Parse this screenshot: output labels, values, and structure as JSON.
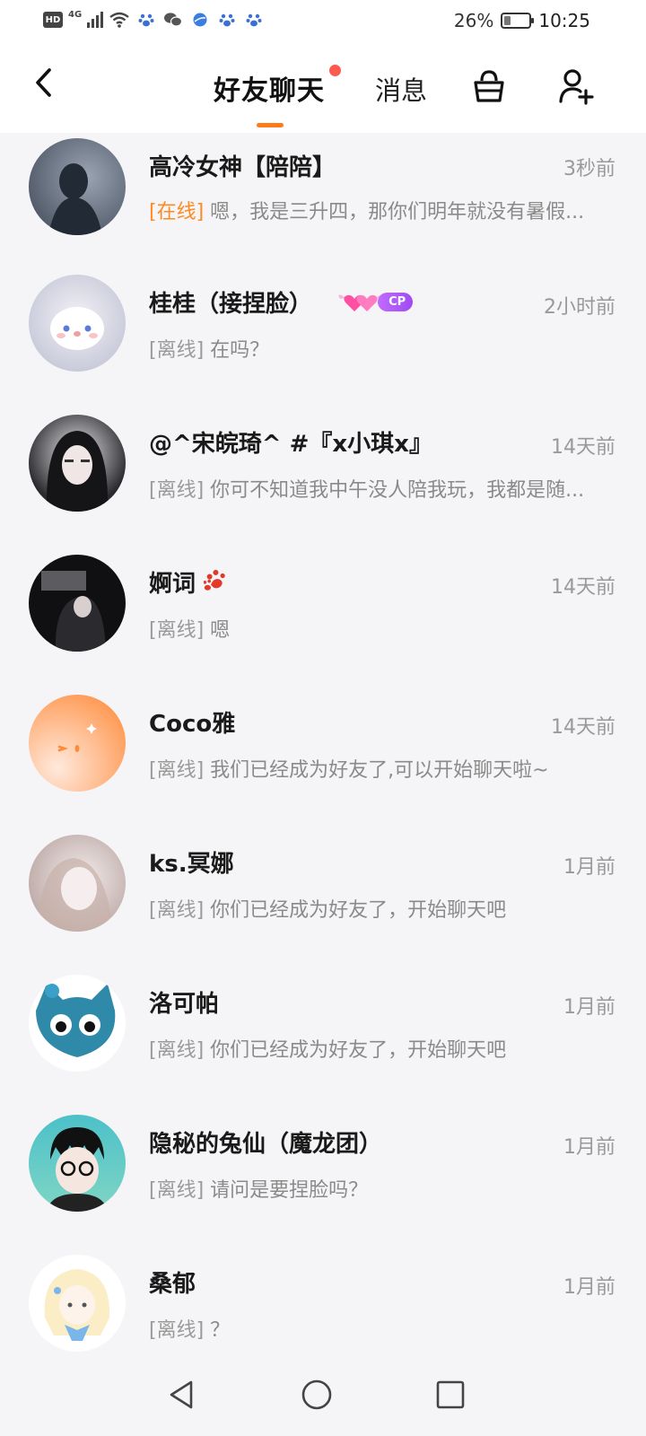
{
  "status_bar": {
    "hd": "HD",
    "signal": "4G",
    "battery": "26%",
    "battery_level": 0.26,
    "time": "10:25"
  },
  "header": {
    "tab_chat": "好友聊天",
    "tab_messages": "消息",
    "accent_color": "#ff7a1a",
    "unread_dot_color": "#ff5a4f"
  },
  "chats": [
    {
      "name": "高冷女神【陪陪】",
      "time": "3秒前",
      "status": "[在线]",
      "preview": "嗯，我是三升四，那你们明年就没有暑假..."
    },
    {
      "name": "桂桂（接捏脸）",
      "time": "2小时前",
      "status": "[离线]",
      "preview": "在吗？",
      "badge": "CP"
    },
    {
      "name": "@^宋皖琦^ #『x小琪x』",
      "time": "14天前",
      "status": "[离线]",
      "preview": "你可不知道我中午没人陪我玩，我都是随..."
    },
    {
      "name": "婀词",
      "time": "14天前",
      "status": "[离线]",
      "preview": "嗯"
    },
    {
      "name": "Coco雅",
      "time": "14天前",
      "status": "[离线]",
      "preview": "我们已经成为好友了,可以开始聊天啦~"
    },
    {
      "name": "ks.冥娜",
      "time": "1月前",
      "status": "[离线]",
      "preview": "你们已经成为好友了，开始聊天吧"
    },
    {
      "name": "洛可帕",
      "time": "1月前",
      "status": "[离线]",
      "preview": "你们已经成为好友了，开始聊天吧"
    },
    {
      "name": "隐秘的兔仙（魔龙团）",
      "time": "1月前",
      "status": "[离线]",
      "preview": "请问是要捏脸吗？"
    },
    {
      "name": "桑郁",
      "time": "1月前",
      "status": "[离线]",
      "preview": "？"
    }
  ],
  "icons": {
    "back": "chevron-left-icon",
    "basket": "shopping-basket-icon",
    "add_friend": "add-user-icon",
    "nav_back": "triangle-back-icon",
    "nav_home": "circle-home-icon",
    "nav_recent": "square-recents-icon"
  }
}
